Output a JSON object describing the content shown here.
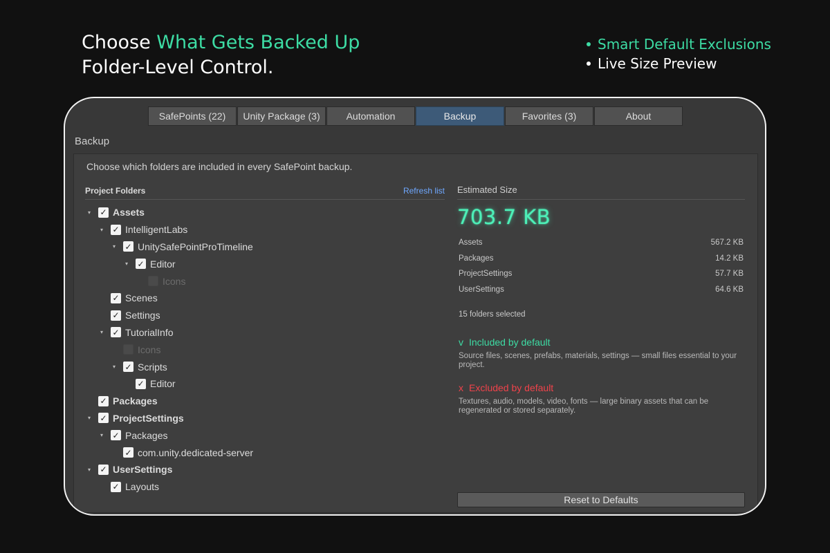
{
  "headline": {
    "line1_prefix": "Choose ",
    "line1_accent": "What Gets Backed Up",
    "line2": "Folder-Level Control."
  },
  "features": [
    "Smart Default Exclusions",
    "Live Size Preview"
  ],
  "colors": {
    "accent": "#3ddca4",
    "excluded": "#f0434b",
    "active_tab": "#3d5a78",
    "link": "#6fa8ff"
  },
  "tabs": [
    {
      "label": "SafePoints (22)",
      "active": false
    },
    {
      "label": "Unity Package (3)",
      "active": false
    },
    {
      "label": "Automation",
      "active": false
    },
    {
      "label": "Backup",
      "active": true
    },
    {
      "label": "Favorites (3)",
      "active": false
    },
    {
      "label": "About",
      "active": false
    }
  ],
  "section_title": "Backup",
  "description": "Choose which folders are included in every SafePoint backup.",
  "tree": {
    "header": "Project Folders",
    "refresh_label": "Refresh list",
    "items": [
      {
        "label": "Assets",
        "depth": 0,
        "expandable": true,
        "checked": true,
        "bold": true
      },
      {
        "label": "IntelligentLabs",
        "depth": 1,
        "expandable": true,
        "checked": true,
        "bold": false
      },
      {
        "label": "UnitySafePointProTimeline",
        "depth": 2,
        "expandable": true,
        "checked": true,
        "bold": false
      },
      {
        "label": "Editor",
        "depth": 3,
        "expandable": true,
        "checked": true,
        "bold": false
      },
      {
        "label": "Icons",
        "depth": 4,
        "expandable": false,
        "checked": false,
        "bold": false
      },
      {
        "label": "Scenes",
        "depth": 1,
        "expandable": false,
        "checked": true,
        "bold": false
      },
      {
        "label": "Settings",
        "depth": 1,
        "expandable": false,
        "checked": true,
        "bold": false
      },
      {
        "label": "TutorialInfo",
        "depth": 1,
        "expandable": true,
        "checked": true,
        "bold": false
      },
      {
        "label": "Icons",
        "depth": 2,
        "expandable": false,
        "checked": false,
        "bold": false
      },
      {
        "label": "Scripts",
        "depth": 2,
        "expandable": true,
        "checked": true,
        "bold": false
      },
      {
        "label": "Editor",
        "depth": 3,
        "expandable": false,
        "checked": true,
        "bold": false
      },
      {
        "label": "Packages",
        "depth": 0,
        "expandable": false,
        "checked": true,
        "bold": true
      },
      {
        "label": "ProjectSettings",
        "depth": 0,
        "expandable": true,
        "checked": true,
        "bold": true
      },
      {
        "label": "Packages",
        "depth": 1,
        "expandable": true,
        "checked": true,
        "bold": false
      },
      {
        "label": "com.unity.dedicated-server",
        "depth": 2,
        "expandable": false,
        "checked": true,
        "bold": false
      },
      {
        "label": "UserSettings",
        "depth": 0,
        "expandable": true,
        "checked": true,
        "bold": true
      },
      {
        "label": "Layouts",
        "depth": 1,
        "expandable": false,
        "checked": true,
        "bold": false
      }
    ]
  },
  "summary": {
    "title": "Estimated Size",
    "total": "703.7 KB",
    "breakdown": [
      {
        "name": "Assets",
        "size": "567.2 KB"
      },
      {
        "name": "Packages",
        "size": "14.2 KB"
      },
      {
        "name": "ProjectSettings",
        "size": "57.7 KB"
      },
      {
        "name": "UserSettings",
        "size": "64.6 KB"
      }
    ],
    "folder_count": "15 folders selected",
    "included": {
      "marker": "v",
      "title": "Included by default",
      "desc": "Source files, scenes, prefabs, materials, settings — small files essential to your project."
    },
    "excluded": {
      "marker": "x",
      "title": "Excluded by default",
      "desc": "Textures, audio, models, video, fonts — large binary assets that can be regenerated or stored separately."
    }
  },
  "reset_label": "Reset to Defaults"
}
